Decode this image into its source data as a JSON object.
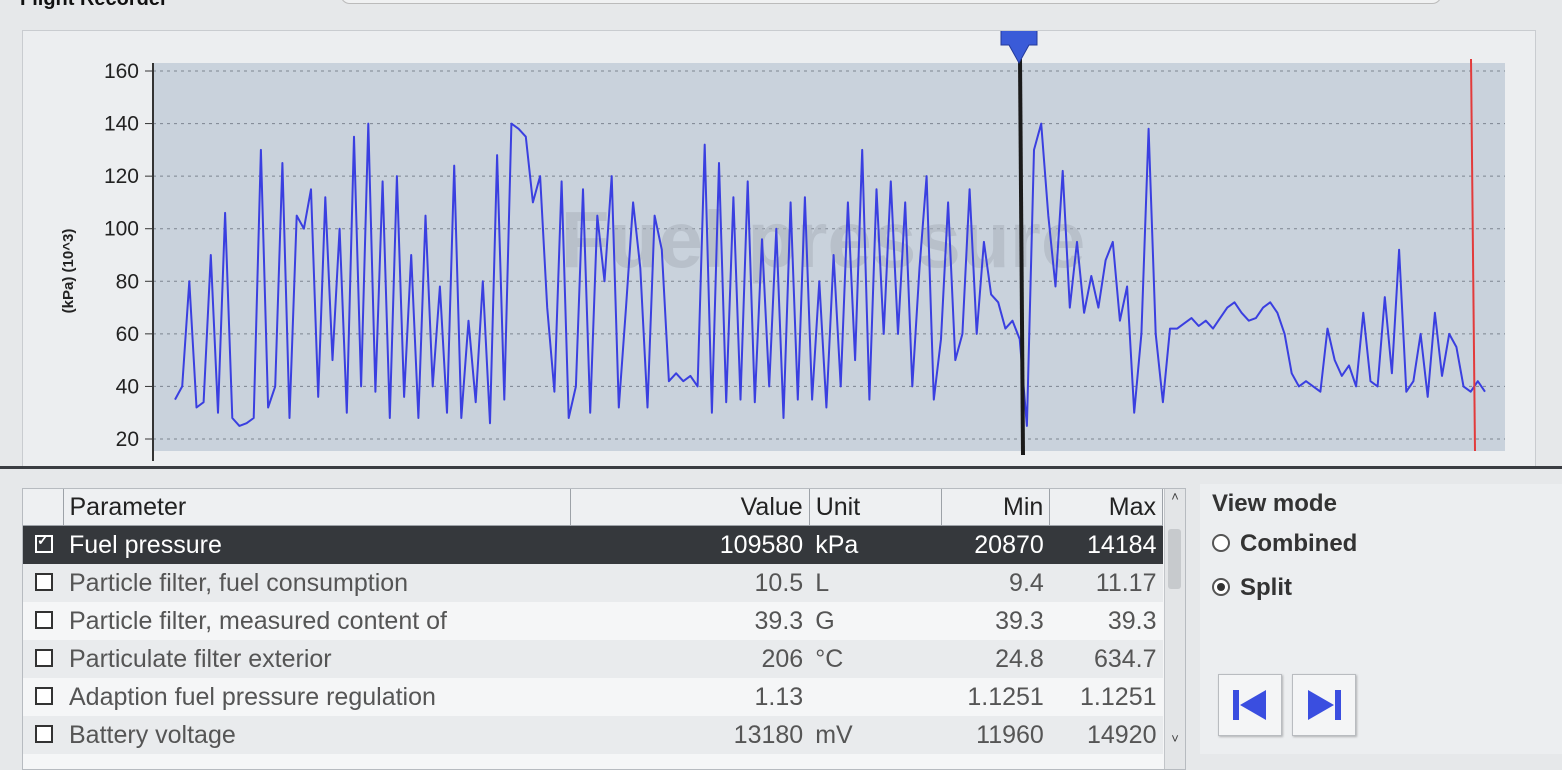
{
  "window": {
    "title": "Flight Recorder"
  },
  "chart": {
    "watermark": "Fuel pressure",
    "colors": {
      "line": "#3a3fe0",
      "cursor": "#1a1a1a",
      "marker": "#e23b3b",
      "plot_bg": "#c9d2dc",
      "marker_arrow": "#3a5bd8"
    }
  },
  "chart_data": {
    "type": "line",
    "title": "",
    "xlabel": "",
    "ylabel": "(kPa) (10^3)",
    "ylim": [
      20,
      160
    ],
    "yticks": [
      20,
      40,
      60,
      80,
      100,
      120,
      140,
      160
    ],
    "grid": true,
    "series": [
      {
        "values": [
          35,
          40,
          80,
          32,
          34,
          90,
          30,
          106,
          28,
          25,
          26,
          28,
          130,
          32,
          40,
          125,
          28,
          105,
          100,
          115,
          36,
          112,
          50,
          100,
          30,
          135,
          40,
          140,
          38,
          118,
          28,
          120,
          36,
          90,
          28,
          105,
          40,
          78,
          30,
          124,
          28,
          65,
          34,
          80,
          26,
          128,
          35,
          140,
          138,
          135,
          110,
          120,
          70,
          38,
          118,
          28,
          40,
          115,
          30,
          105,
          80,
          120,
          32,
          70,
          110,
          85,
          32,
          105,
          92,
          42,
          45,
          42,
          44,
          40,
          132,
          30,
          125,
          34,
          112,
          35,
          118,
          34,
          96,
          40,
          100,
          28,
          110,
          35,
          112,
          35,
          80,
          32,
          90,
          40,
          110,
          50,
          130,
          35,
          115,
          60,
          118,
          60,
          110,
          40,
          85,
          120,
          35,
          58,
          110,
          50,
          60,
          115,
          60,
          95,
          75,
          72,
          62,
          65,
          58,
          25,
          130,
          140,
          105,
          78,
          122,
          70,
          95,
          68,
          82,
          70,
          88,
          95,
          65,
          78,
          30,
          60,
          138,
          60,
          34,
          62,
          62,
          64,
          66,
          63,
          65,
          62,
          66,
          70,
          72,
          68,
          65,
          66,
          70,
          72,
          68,
          60,
          45,
          40,
          42,
          40,
          38,
          62,
          50,
          44,
          48,
          40,
          68,
          42,
          40,
          74,
          45,
          92,
          38,
          42,
          60,
          36,
          68,
          44,
          60,
          55,
          40,
          38,
          42,
          38
        ]
      }
    ],
    "cursor_marker": true
  },
  "table": {
    "headers": {
      "parameter": "Parameter",
      "value": "Value",
      "unit": "Unit",
      "min": "Min",
      "max": "Max"
    },
    "rows": [
      {
        "checked": true,
        "parameter": "Fuel pressure",
        "value": "109580",
        "unit": "kPa",
        "min": "20870",
        "max": "14184"
      },
      {
        "checked": false,
        "parameter": "Particle filter, fuel consumption",
        "value": "10.5",
        "unit": "L",
        "min": "9.4",
        "max": "11.17"
      },
      {
        "checked": false,
        "parameter": "Particle filter, measured content of",
        "value": "39.3",
        "unit": "G",
        "min": "39.3",
        "max": "39.3"
      },
      {
        "checked": false,
        "parameter": "Particulate filter exterior",
        "value": "206",
        "unit": "°C",
        "min": "24.8",
        "max": "634.7"
      },
      {
        "checked": false,
        "parameter": "Adaption fuel pressure regulation",
        "value": "1.13",
        "unit": "",
        "min": "1.1251",
        "max": "1.1251"
      },
      {
        "checked": false,
        "parameter": "Battery voltage",
        "value": "13180",
        "unit": "mV",
        "min": "11960",
        "max": "14920"
      }
    ]
  },
  "view_mode": {
    "title": "View mode",
    "options": [
      {
        "label": "Combined",
        "selected": false
      },
      {
        "label": "Split",
        "selected": true
      }
    ],
    "nav": {
      "prev_icon": "skip-to-start-icon",
      "next_icon": "skip-to-end-icon"
    }
  }
}
